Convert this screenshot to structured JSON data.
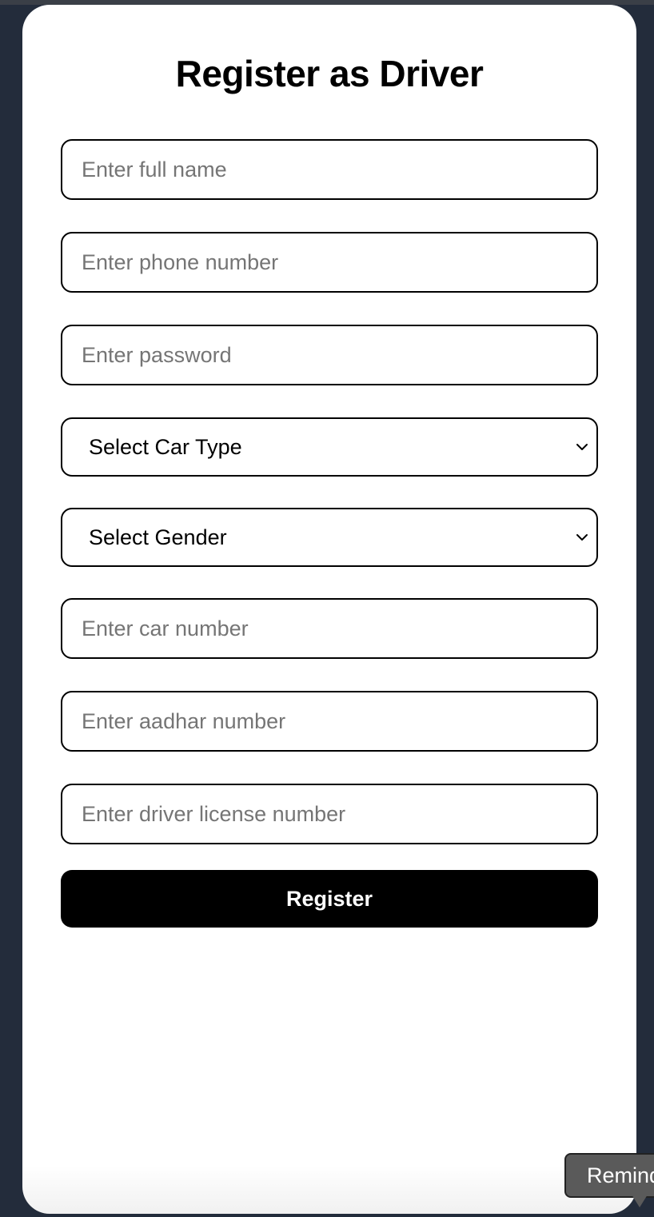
{
  "form": {
    "title": "Register as Driver",
    "fields": {
      "full_name": {
        "placeholder": "Enter full name",
        "value": ""
      },
      "phone": {
        "placeholder": "Enter phone number",
        "value": ""
      },
      "password": {
        "placeholder": "Enter password",
        "value": ""
      },
      "car_number": {
        "placeholder": "Enter car number",
        "value": ""
      },
      "aadhar": {
        "placeholder": "Enter aadhar number",
        "value": ""
      },
      "license": {
        "placeholder": "Enter driver license number",
        "value": ""
      }
    },
    "selects": {
      "car_type": {
        "selected": "Select Car Type"
      },
      "gender": {
        "selected": "Select Gender"
      }
    },
    "submit_label": "Register"
  },
  "tooltip": {
    "text": "Remind"
  },
  "colors": {
    "background": "#232c3b",
    "card": "#ffffff",
    "button": "#000000",
    "button_text": "#ffffff",
    "placeholder": "#757575"
  },
  "icons": {
    "select_chevron": "chevron-down-icon"
  }
}
